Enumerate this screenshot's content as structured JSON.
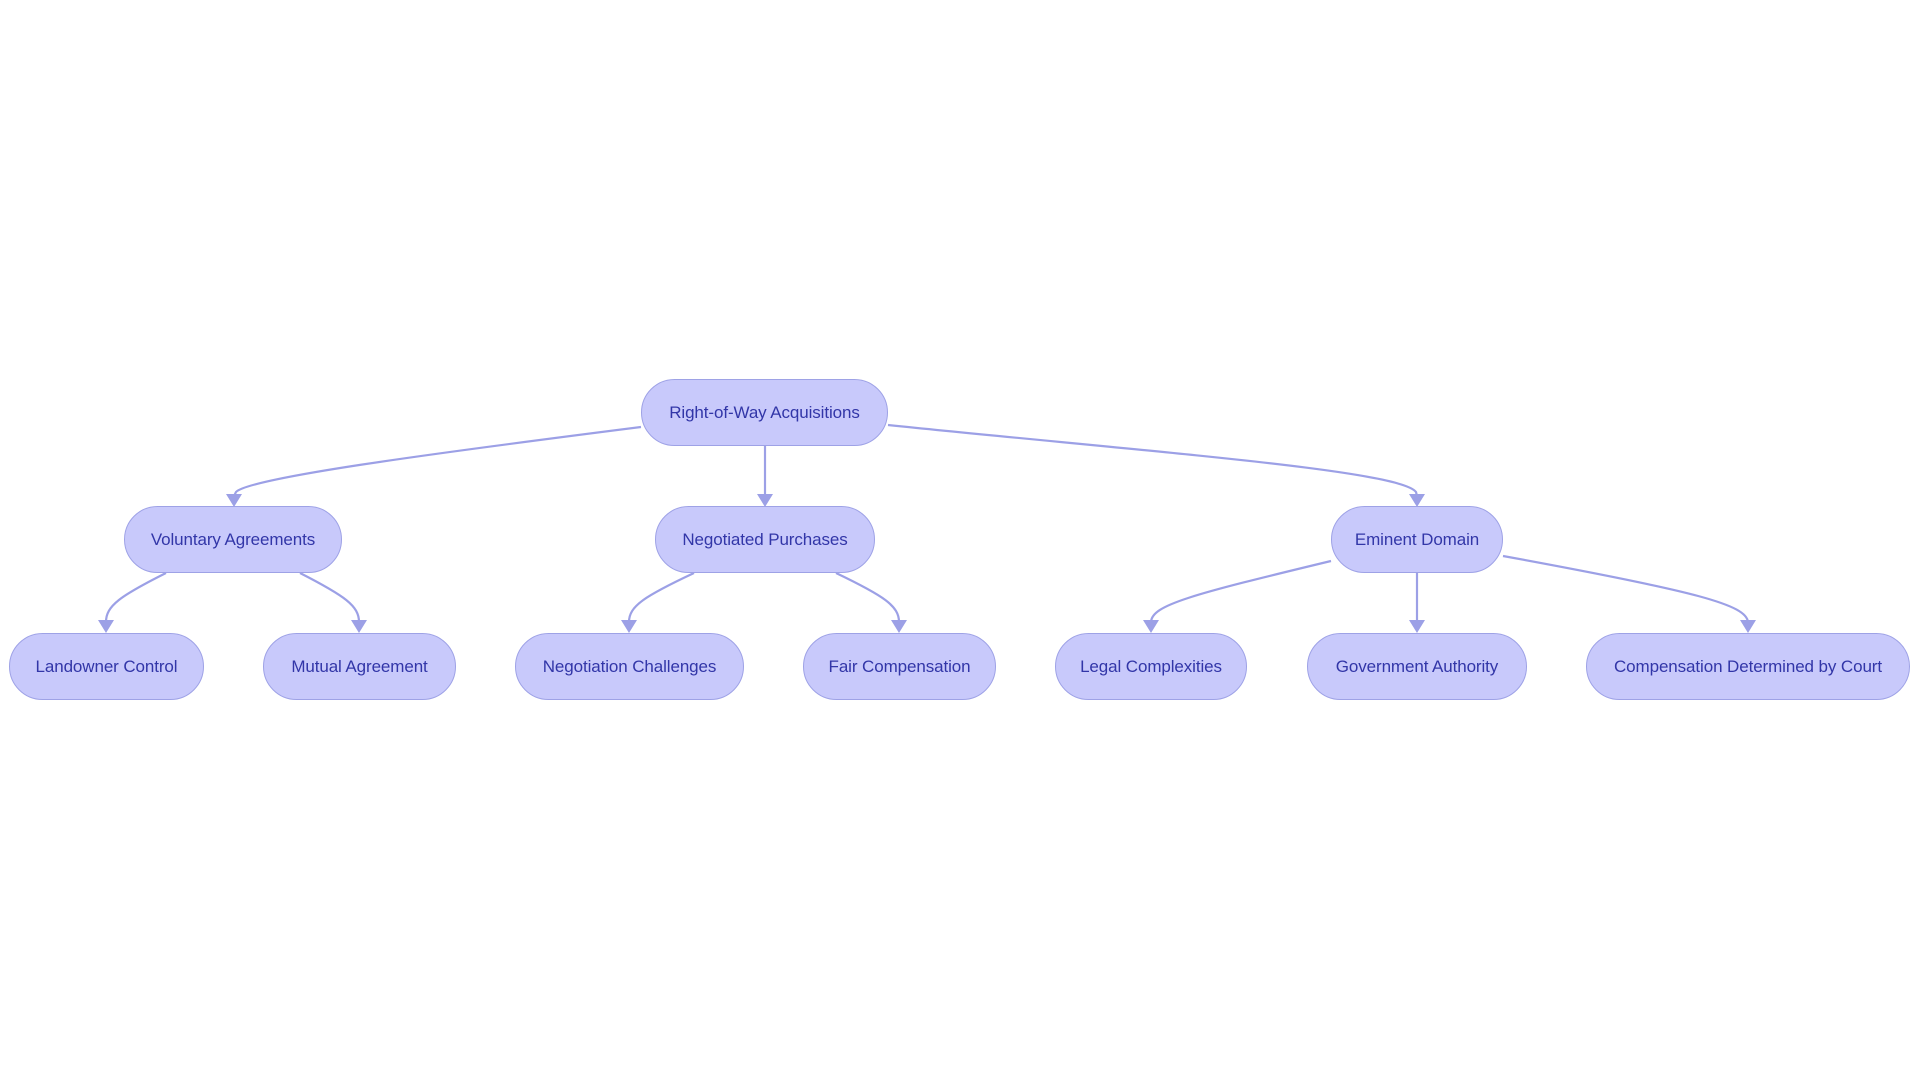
{
  "diagram": {
    "type": "flowchart-tree",
    "colors": {
      "node_fill": "#c8c9fb",
      "node_border": "#9ea2e6",
      "node_text": "#3236a8",
      "edge": "#9ca0e6",
      "background": "#ffffff"
    },
    "nodes": {
      "root": {
        "label": "Right-of-Way Acquisitions"
      },
      "voluntary": {
        "label": "Voluntary Agreements"
      },
      "negotiated": {
        "label": "Negotiated Purchases"
      },
      "eminent": {
        "label": "Eminent Domain"
      },
      "landowner": {
        "label": "Landowner Control"
      },
      "mutual": {
        "label": "Mutual Agreement"
      },
      "challenges": {
        "label": "Negotiation Challenges"
      },
      "fair": {
        "label": "Fair Compensation"
      },
      "legal": {
        "label": "Legal Complexities"
      },
      "government": {
        "label": "Government Authority"
      },
      "court": {
        "label": "Compensation Determined by Court"
      }
    },
    "edges": [
      {
        "from": "root",
        "to": "voluntary"
      },
      {
        "from": "root",
        "to": "negotiated"
      },
      {
        "from": "root",
        "to": "eminent"
      },
      {
        "from": "voluntary",
        "to": "landowner"
      },
      {
        "from": "voluntary",
        "to": "mutual"
      },
      {
        "from": "negotiated",
        "to": "challenges"
      },
      {
        "from": "negotiated",
        "to": "fair"
      },
      {
        "from": "eminent",
        "to": "legal"
      },
      {
        "from": "eminent",
        "to": "government"
      },
      {
        "from": "eminent",
        "to": "court"
      }
    ]
  }
}
